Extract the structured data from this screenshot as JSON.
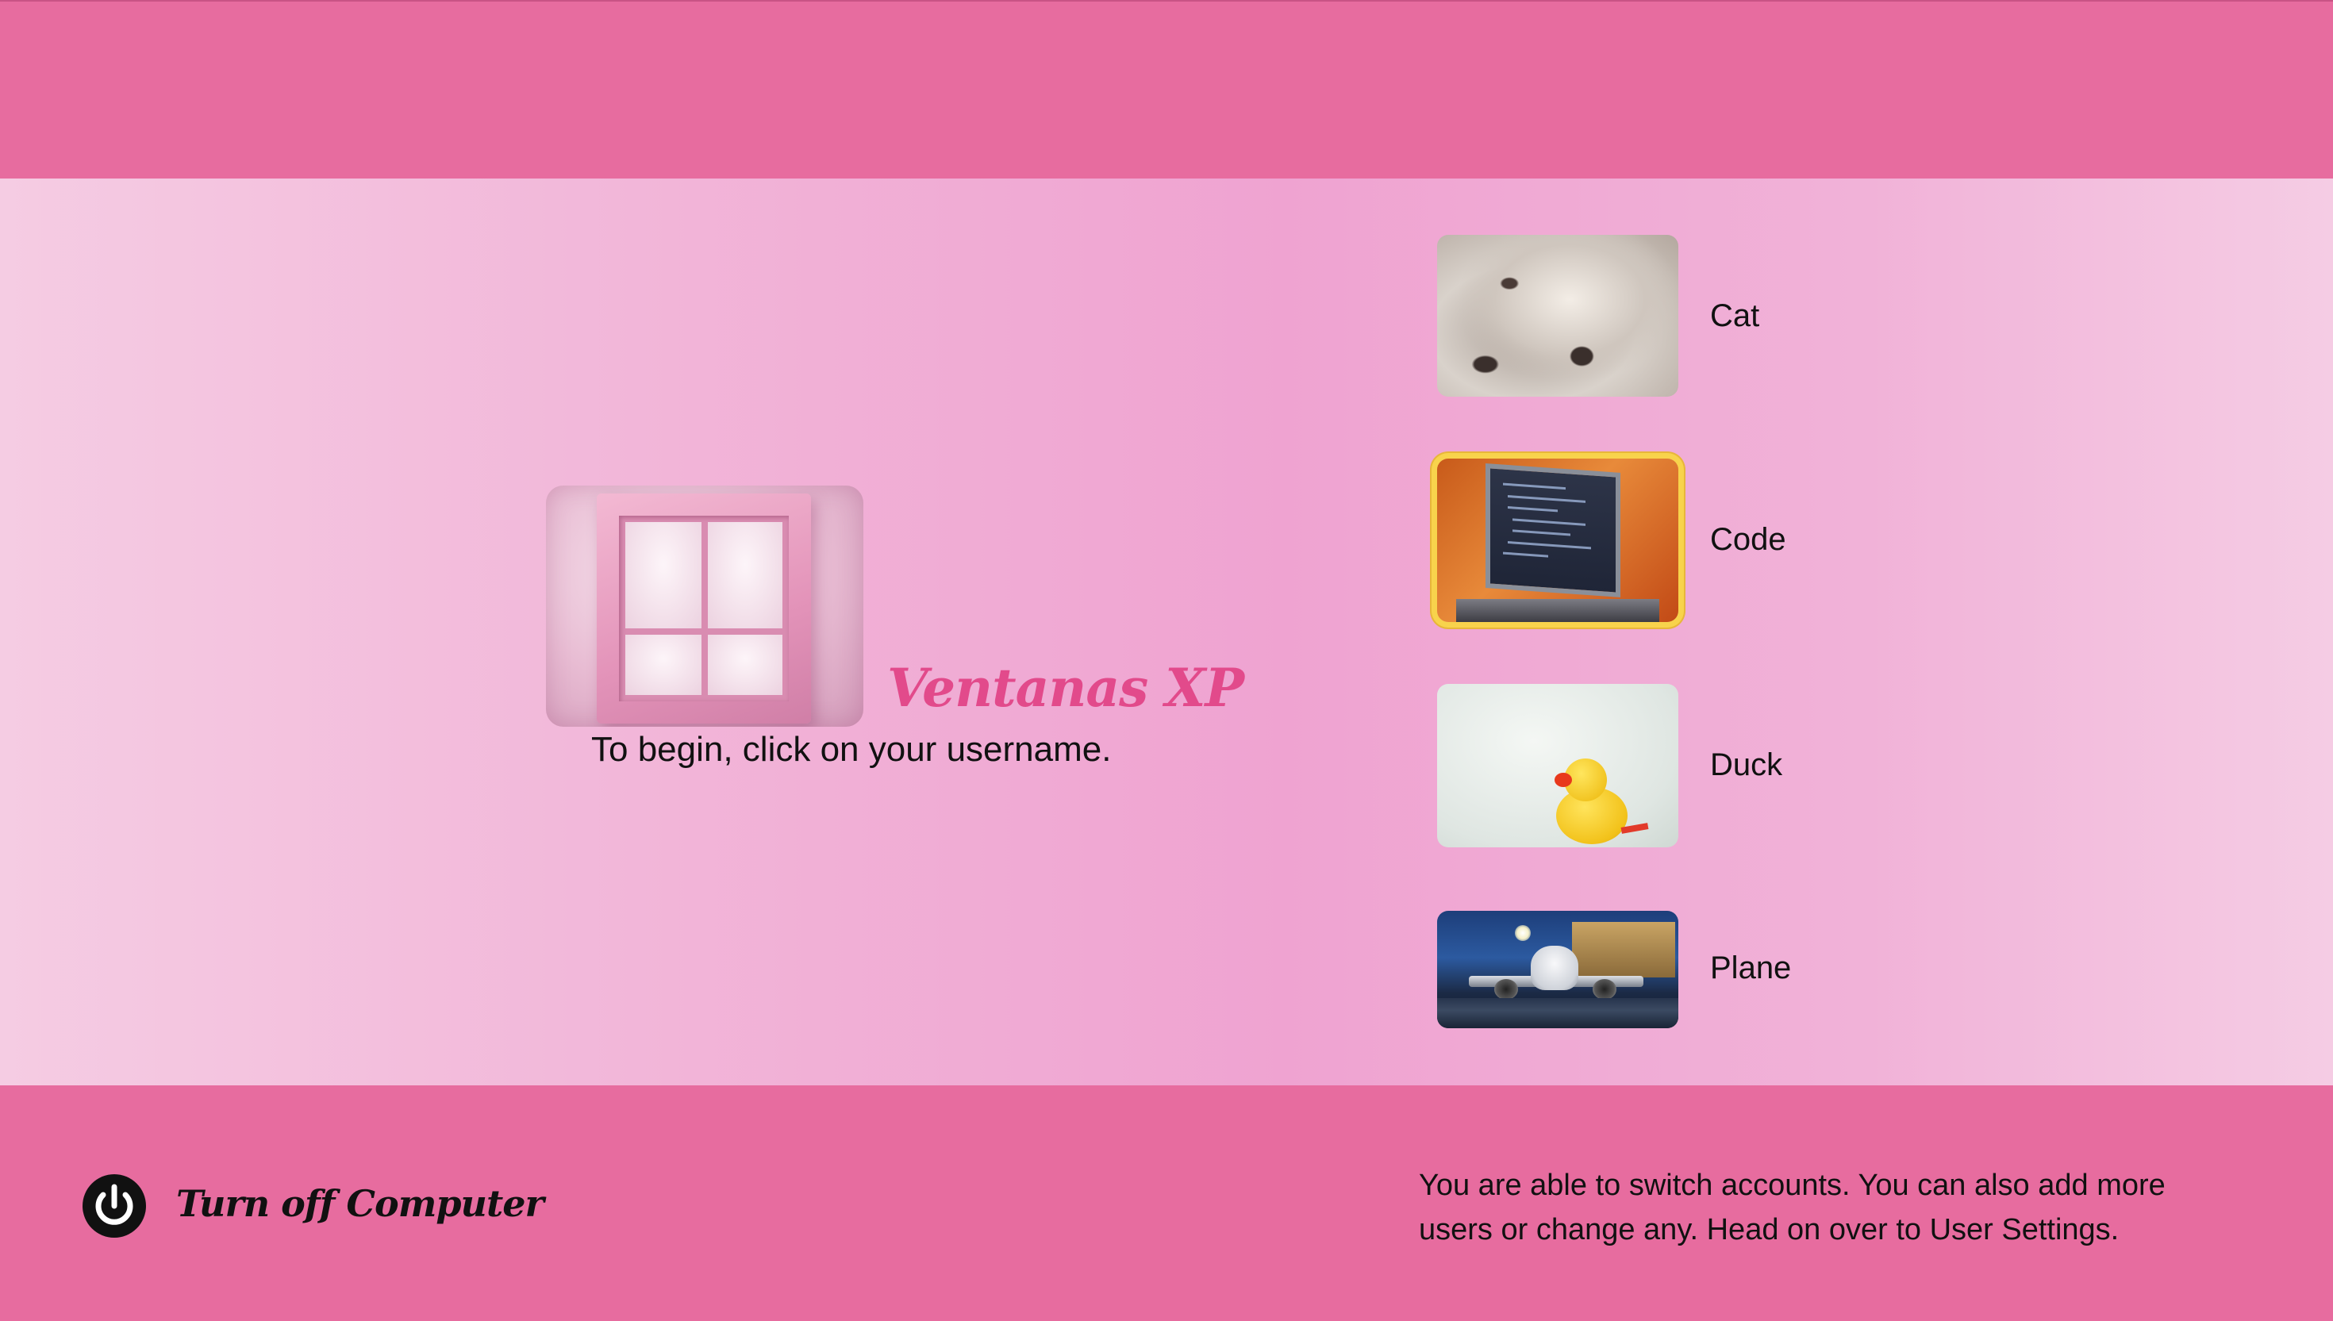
{
  "brand": {
    "title": "Ventanas XP",
    "instruction": "To begin, click on your username."
  },
  "users": [
    {
      "name": "Cat",
      "image": "cat-photo",
      "selected": false
    },
    {
      "name": "Code",
      "image": "laptop-code-photo",
      "selected": true
    },
    {
      "name": "Duck",
      "image": "rubber-duck-photo",
      "selected": false
    },
    {
      "name": "Plane",
      "image": "airplane-photo",
      "selected": false
    }
  ],
  "footer": {
    "power_label": "Turn off Computer",
    "power_icon": "power-icon",
    "note": "You are able to switch accounts. You can also add more users or change any. Head on over to User Settings."
  },
  "colors": {
    "bar": "#e76c9f",
    "brand_title": "#e24a8b",
    "selected_ring": "#f8d34c"
  }
}
